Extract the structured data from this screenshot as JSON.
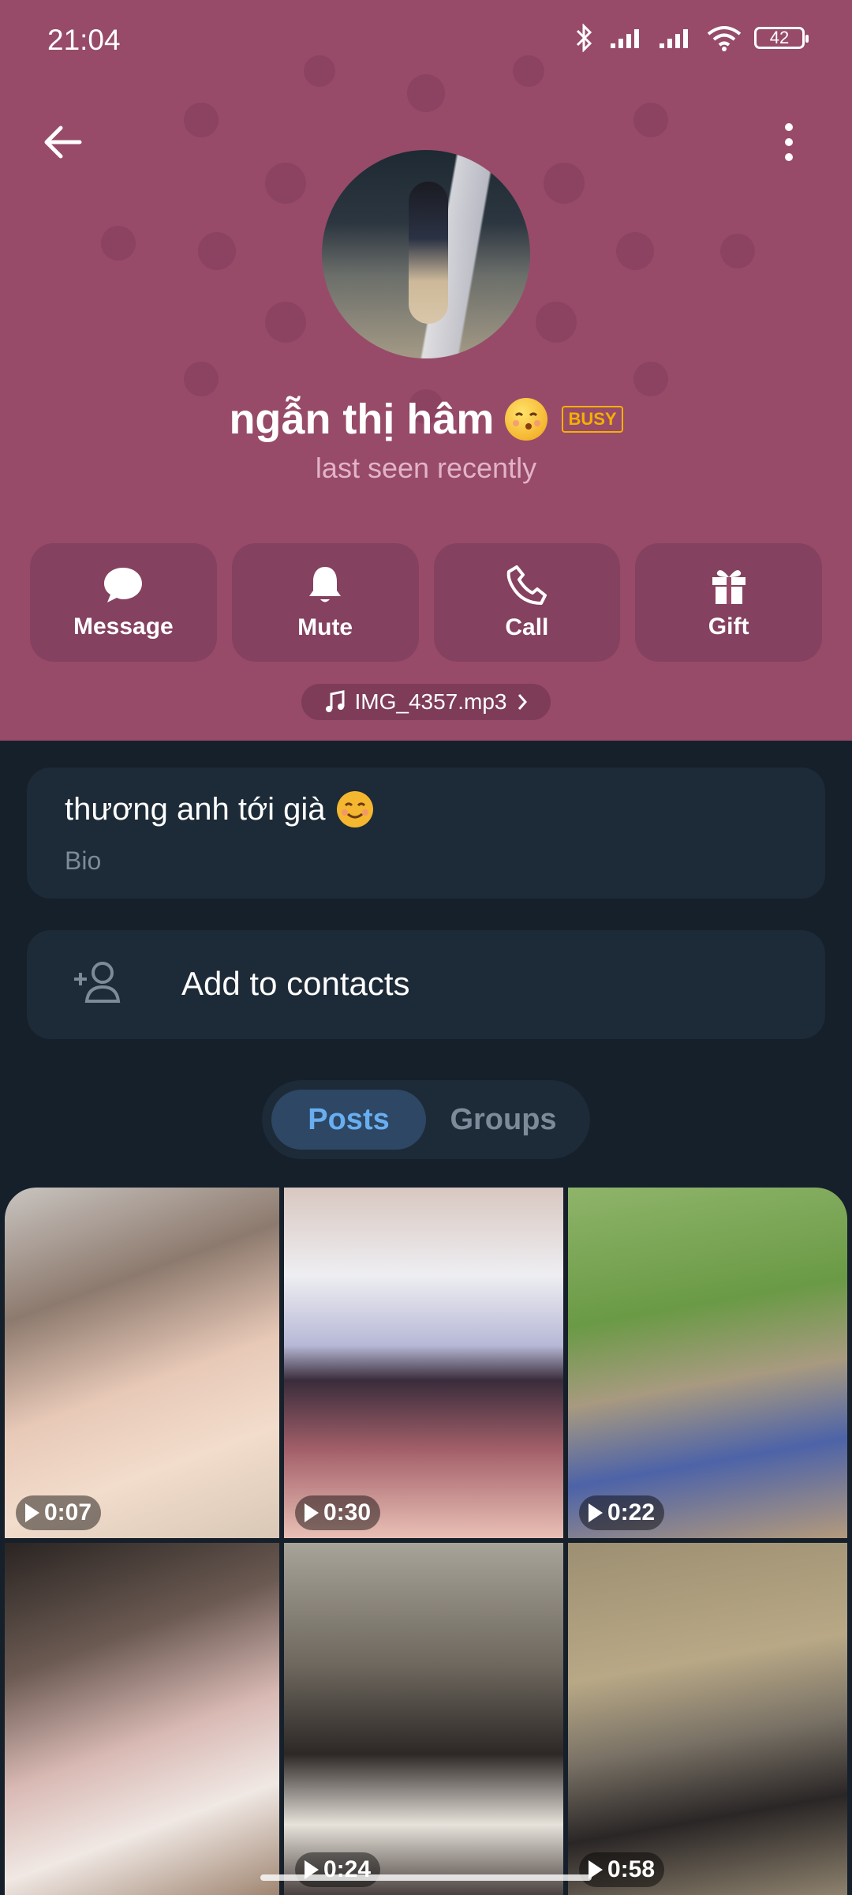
{
  "status": {
    "time": "21:04",
    "battery": "42"
  },
  "profile": {
    "name": "ngẫn thị hâm",
    "badge": "BUSY",
    "status": "last seen recently"
  },
  "actions": [
    {
      "label": "Message",
      "icon": "chat-bubble-icon"
    },
    {
      "label": "Mute",
      "icon": "bell-icon"
    },
    {
      "label": "Call",
      "icon": "phone-icon"
    },
    {
      "label": "Gift",
      "icon": "gift-icon"
    }
  ],
  "music": {
    "label": "IMG_4357.mp3"
  },
  "bio": {
    "text": "thương anh tới già",
    "label": "Bio"
  },
  "contacts": {
    "label": "Add to contacts"
  },
  "tabs": [
    {
      "label": "Posts"
    },
    {
      "label": "Groups"
    }
  ],
  "media": [
    {
      "duration": "0:07"
    },
    {
      "duration": "0:30"
    },
    {
      "duration": "0:22"
    },
    {
      "duration": ""
    },
    {
      "duration": "0:24"
    },
    {
      "duration": "0:58"
    }
  ],
  "colors": {
    "header": "#974b68",
    "action_button": "#854160",
    "background": "#16202b",
    "card": "#1d2a38",
    "accent": "#68aef0",
    "busy": "#f5b000"
  }
}
